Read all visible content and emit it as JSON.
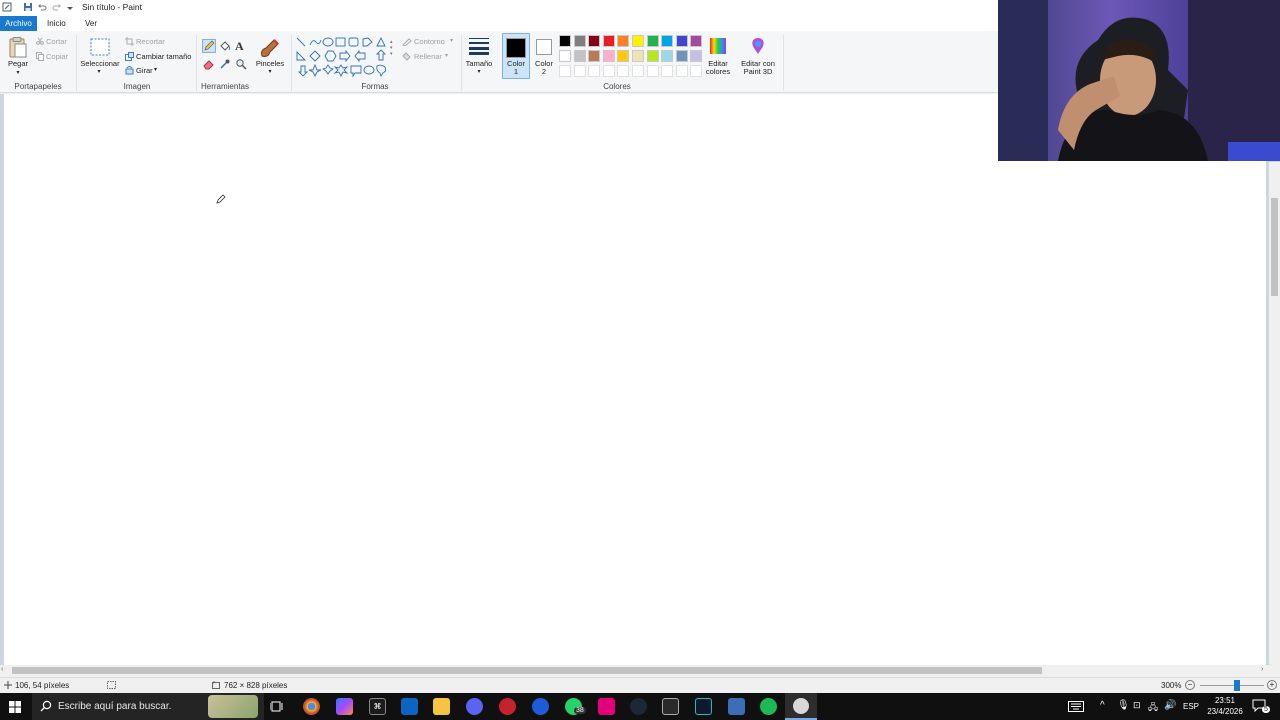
{
  "window": {
    "title": "Sin título - Paint"
  },
  "tabs": [
    {
      "label": "Archivo"
    },
    {
      "label": "Inicio"
    },
    {
      "label": "Ver"
    }
  ],
  "ribbon": {
    "clipboard": {
      "paste_label": "Pegar",
      "cut_label": "Cortar",
      "copy_label": "Copiar",
      "group_label": "Portapapeles"
    },
    "image": {
      "select_label": "Seleccionar",
      "crop_label": "Recortar",
      "resize_label": "Cambiar tamaño",
      "rotate_label": "Girar",
      "group_label": "Imagen"
    },
    "tools": {
      "group_label": "Herramientas",
      "brushes_label": "Pinceles"
    },
    "shapes": {
      "outline_label": "Contorno",
      "fill_label": "Rellenar",
      "group_label": "Formas"
    },
    "size": {
      "label": "Tamaño"
    },
    "colors": {
      "color1_label_line1": "Color",
      "color1_label_line2": "1",
      "color2_label_line1": "Color",
      "color2_label_line2": "2",
      "edit_colors_line1": "Editar",
      "edit_colors_line2": "colores",
      "edit_paint3d_line1": "Editar con",
      "edit_paint3d_line2": "Paint 3D",
      "group_label": "Colores",
      "color1": "#000000",
      "color2": "#ffffff",
      "palette_row1": [
        "#000000",
        "#7f7f7f",
        "#880015",
        "#ed1c24",
        "#ff7f27",
        "#fff200",
        "#22b14c",
        "#00a2e8",
        "#3f48cc",
        "#a349a4"
      ],
      "palette_row2": [
        "#ffffff",
        "#c3c3c3",
        "#b97a57",
        "#ffaec9",
        "#ffc90e",
        "#efe4b0",
        "#b5e61d",
        "#99d9ea",
        "#7092be",
        "#c8bfe7"
      ]
    }
  },
  "status": {
    "cursor_position": "106, 54 píxeles",
    "image_size": "762 × 828 píxeles",
    "zoom": "300%"
  },
  "taskbar": {
    "search_placeholder": "Escribe aquí para buscar.",
    "whatsapp_badge": "38",
    "language": "ESP",
    "time": "23:51",
    "date": "23/4/2026",
    "notification_count": "5"
  }
}
